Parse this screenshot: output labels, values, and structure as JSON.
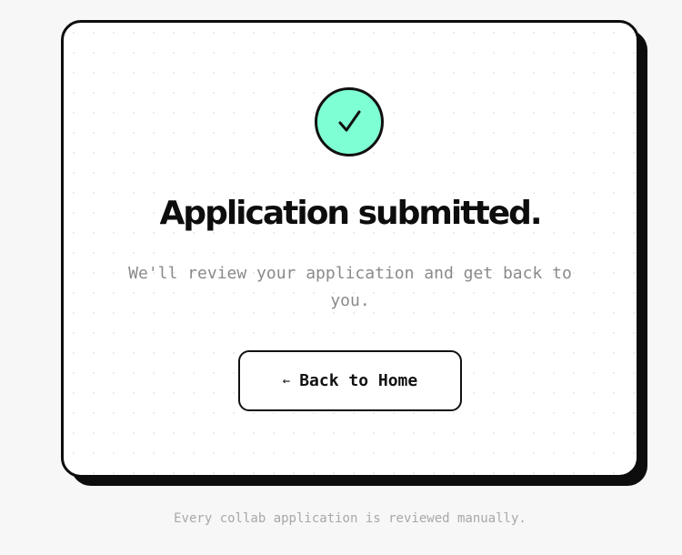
{
  "card": {
    "title": "Application submitted.",
    "message": "We'll review your application and get back to you.",
    "check_icon": "checkmark-icon",
    "check_glyph": "✓"
  },
  "home_button": {
    "arrow_glyph": "←",
    "label": "Back to Home"
  },
  "footer": {
    "note": "Every collab application is reviewed manually."
  },
  "colors": {
    "accent": "#7fffd4",
    "ink": "#0d0d0d",
    "muted_text": "#8a8a8a",
    "background": "#f7f7f7"
  }
}
